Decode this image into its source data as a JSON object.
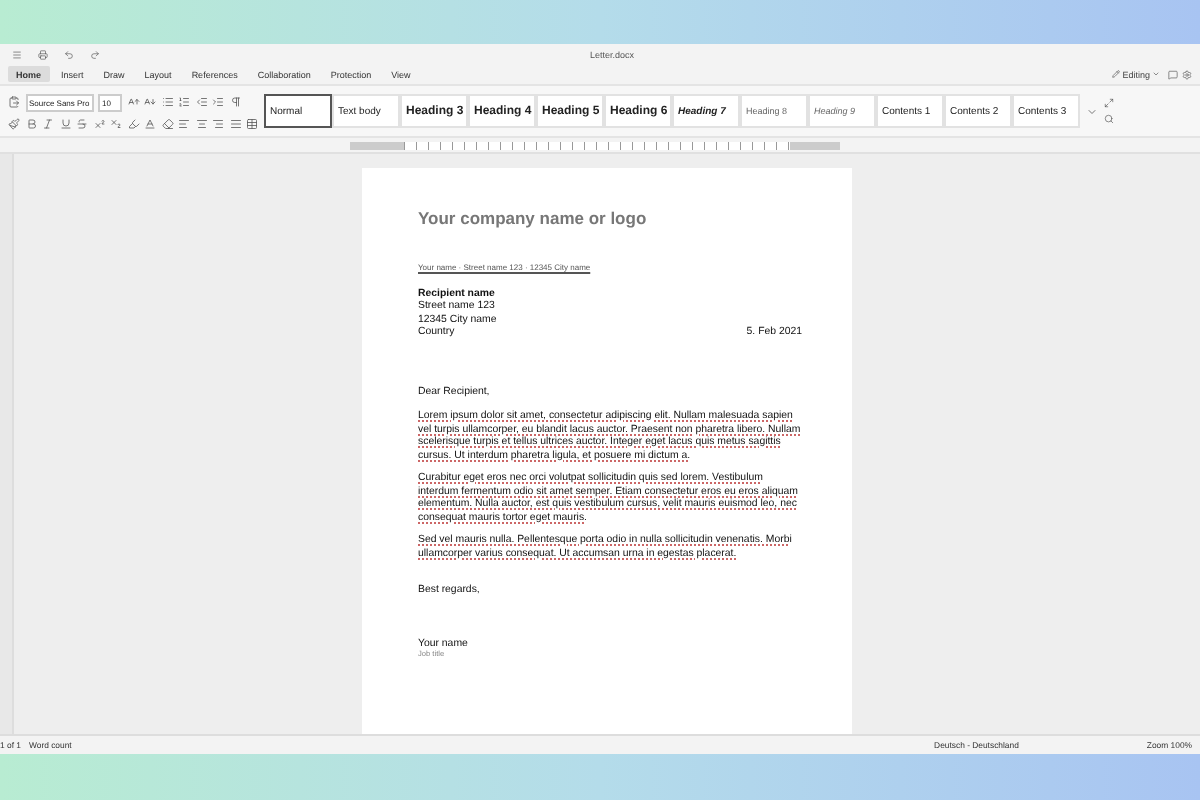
{
  "window": {
    "title": "Letter.docx"
  },
  "menu_tabs": [
    {
      "label": "Home",
      "selected": true
    },
    {
      "label": "Insert",
      "selected": false
    },
    {
      "label": "Draw",
      "selected": false
    },
    {
      "label": "Layout",
      "selected": false
    },
    {
      "label": "References",
      "selected": false
    },
    {
      "label": "Collaboration",
      "selected": false
    },
    {
      "label": "Protection",
      "selected": false
    },
    {
      "label": "View",
      "selected": false
    }
  ],
  "mode": "Editing",
  "font": {
    "name": "Source Sans Pro",
    "size": "10"
  },
  "styles": [
    {
      "label": "Normal",
      "kind": "plain",
      "selected": true
    },
    {
      "label": "Text body",
      "kind": "plain",
      "selected": false
    },
    {
      "label": "Heading 3",
      "kind": "heading",
      "selected": false
    },
    {
      "label": "Heading 4",
      "kind": "heading",
      "selected": false
    },
    {
      "label": "Heading 5",
      "kind": "heading",
      "selected": false
    },
    {
      "label": "Heading 6",
      "kind": "heading",
      "selected": false
    },
    {
      "label": "Heading 7",
      "kind": "heading-italic",
      "selected": false
    },
    {
      "label": "Heading 8",
      "kind": "light",
      "selected": false
    },
    {
      "label": "Heading 9",
      "kind": "light-italic",
      "selected": false
    },
    {
      "label": "Contents 1",
      "kind": "plain",
      "selected": false
    },
    {
      "label": "Contents 2",
      "kind": "plain",
      "selected": false
    },
    {
      "label": "Contents 3",
      "kind": "plain",
      "selected": false
    }
  ],
  "document": {
    "company": "Your company name or logo",
    "sender": "Your name · Street name 123 · 12345 City name",
    "recipient": [
      "Recipient name",
      "Street name 123",
      "12345 City name",
      "Country"
    ],
    "date": "5. Feb 2021",
    "salutation": "Dear Recipient,",
    "paragraphs": [
      "Lorem ipsum dolor sit amet, consectetur adipiscing elit. Nullam malesuada sapien vel turpis ullamcorper, eu blandit lacus auctor. Praesent non pharetra libero. Nullam scelerisque turpis et tellus ultrices auctor. Integer eget lacus quis metus sagittis cursus. Ut interdum pharetra ligula, et posuere mi dictum a.",
      "Curabitur eget eros nec orci volutpat sollicitudin quis sed lorem. Vestibulum interdum fermentum odio sit amet semper. Etiam consectetur eros eu eros aliquam elementum. Nulla auctor, est quis vestibulum cursus, velit mauris euismod leo, nec consequat mauris tortor eget mauris.",
      "Sed vel mauris nulla. Pellentesque porta odio in nulla sollicitudin venenatis. Morbi ullamcorper varius consequat. Ut accumsan urna in egestas placerat."
    ],
    "closing": "Best regards,",
    "signature": "Your name",
    "job_title": "Job title"
  },
  "status_bar": {
    "page": "1 of 1",
    "word_count": "Word count",
    "language": "Deutsch - Deutschland",
    "zoom": "Zoom 100%"
  }
}
